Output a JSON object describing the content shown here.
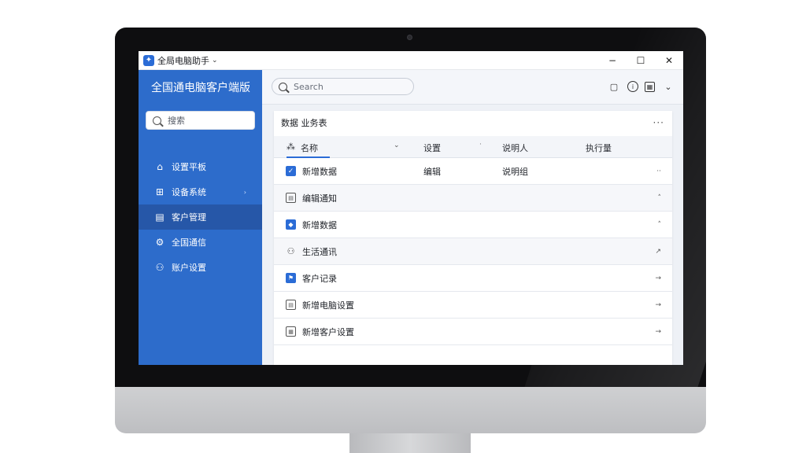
{
  "window": {
    "title": "全局电脑助手",
    "title_chevron": "⌄",
    "minimize": "−",
    "maximize": "☐",
    "close": "✕"
  },
  "sidebar": {
    "app_name": "全国通电脑客户端版",
    "search_placeholder": "搜索",
    "items": [
      {
        "label": "设置平板",
        "icon": "home-icon",
        "glyph": "⌂",
        "active": false,
        "arrow": ""
      },
      {
        "label": "设备系统",
        "icon": "grid-icon",
        "glyph": "⊞",
        "active": false,
        "arrow": "›"
      },
      {
        "label": "客户管理",
        "icon": "folder-icon",
        "glyph": "▤",
        "active": true,
        "arrow": ""
      },
      {
        "label": "全国通信",
        "icon": "gear-icon",
        "glyph": "⚙",
        "active": false,
        "arrow": ""
      },
      {
        "label": "账户设置",
        "icon": "users-icon",
        "glyph": "⚇",
        "active": false,
        "arrow": ""
      }
    ]
  },
  "topbar": {
    "search_placeholder": "Search",
    "icons": [
      {
        "name": "chat-icon",
        "glyph": "▢"
      },
      {
        "name": "info-icon",
        "glyph": "i"
      },
      {
        "name": "calendar-icon",
        "glyph": "▦"
      },
      {
        "name": "chevron-down-icon",
        "glyph": "⌄"
      }
    ]
  },
  "panel": {
    "title": "数据 业务表",
    "more": "···",
    "columns": {
      "c1": "名称",
      "c1_icon": "⁂",
      "c1_chev": "⌄",
      "c2": "设置",
      "c2_dot": "·",
      "c3": "说明人",
      "c4": "执行量"
    },
    "rows": [
      {
        "icon": "check",
        "glyph": "✓",
        "label": "新增数据",
        "col2": "编辑",
        "col3": "说明组",
        "action": "··",
        "shade": false
      },
      {
        "icon": "grey",
        "glyph": "▤",
        "label": "编辑通知",
        "col2": "",
        "col3": "",
        "action": "˄",
        "shade": true
      },
      {
        "icon": "blue",
        "glyph": "◆",
        "label": "新增数据",
        "col2": "",
        "col3": "",
        "action": "˄",
        "shade": false
      },
      {
        "icon": "person",
        "glyph": "⚇",
        "label": "生活通讯",
        "col2": "",
        "col3": "",
        "action": "↗",
        "shade": true
      },
      {
        "icon": "blue",
        "glyph": "⚑",
        "label": "客户记录",
        "col2": "",
        "col3": "",
        "action": "→",
        "shade": false
      },
      {
        "icon": "grey",
        "glyph": "▤",
        "label": "新增电脑设置",
        "col2": "",
        "col3": "",
        "action": "→",
        "shade": false
      },
      {
        "icon": "grey",
        "glyph": "▦",
        "label": "新增客户设置",
        "col2": "",
        "col3": "",
        "action": "→",
        "shade": false
      }
    ]
  },
  "colors": {
    "sidebar": "#2d6ccb",
    "sidebar_active": "#2657a8",
    "accent": "#2b6cd6"
  }
}
